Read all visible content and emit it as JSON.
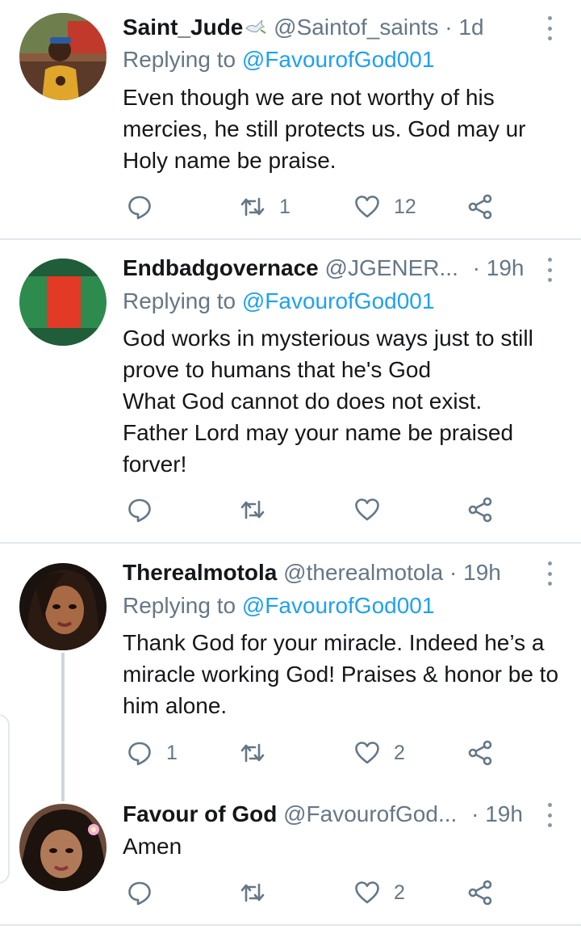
{
  "tweets": [
    {
      "name": "Saint_Jude",
      "emoji": "dove-icon",
      "handle": "@Saintof_saints",
      "separator": "·",
      "time": "1d",
      "replying_prefix": "Replying to",
      "replying_to": "@FavourofGod001",
      "text": "Even though we are not worthy of his mercies, he still protects us. God may ur Holy name be praise.",
      "retweets": "1",
      "likes": "12"
    },
    {
      "name": "Endbadgovernace",
      "handle": "@JGENER...",
      "separator": "·",
      "time": "19h",
      "replying_prefix": "Replying to",
      "replying_to": "@FavourofGod001",
      "text": "God works in mysterious ways just to still prove to humans that he's God\nWhat God cannot do does not exist.\nFather Lord may your name be praised forver!"
    },
    {
      "name": "Therealmotola",
      "handle": "@therealmotola",
      "separator": "·",
      "time": "19h",
      "replying_prefix": "Replying to",
      "replying_to": "@FavourofGod001",
      "text": "Thank God for your miracle. Indeed he’s a miracle working God! Praises & honor be to him alone.",
      "replies": "1",
      "likes": "2"
    },
    {
      "name": "Favour of God",
      "handle": "@FavourofGod...",
      "separator": "·",
      "time": "19h",
      "text": "Amen",
      "likes": "2"
    }
  ],
  "colors": {
    "text": "#14171a",
    "secondary": "#657786",
    "link": "#1da1f2",
    "divider": "#e1e8ed"
  }
}
